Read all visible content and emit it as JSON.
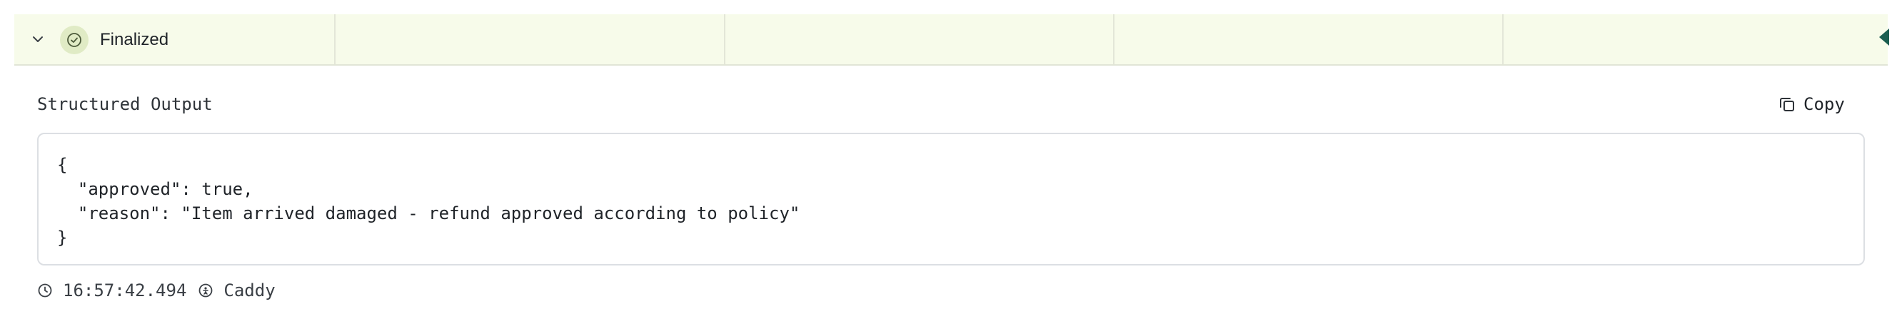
{
  "run": {
    "status_label": "Finalized"
  },
  "output": {
    "section_title": "Structured Output",
    "copy_label": "Copy",
    "code_lines": [
      "{",
      "  \"approved\": true,",
      "  \"reason\": \"Item arrived damaged - refund approved according to policy\"",
      "}"
    ]
  },
  "meta": {
    "timestamp": "16:57:42.494",
    "agent": "Caddy"
  },
  "colors": {
    "row_background": "#f7fbea",
    "status_icon_bg": "#e0ebc5",
    "accent_marker": "#1b5e50"
  },
  "icons": {
    "expand": "chevron-down-icon",
    "status": "check-circle-icon",
    "copy": "copy-icon",
    "time": "clock-icon",
    "agent": "agent-icon"
  }
}
